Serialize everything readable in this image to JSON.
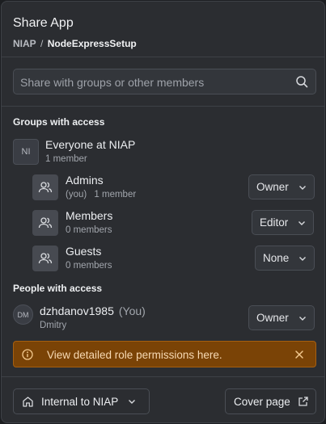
{
  "dialog": {
    "title": "Share App",
    "breadcrumb": {
      "org": "NIAP",
      "separator": "/",
      "app": "NodeExpressSetup"
    }
  },
  "search": {
    "placeholder": "Share with groups or other members",
    "icon": "search-icon"
  },
  "groups_section": {
    "label": "Groups with access",
    "org_group": {
      "initials": "NI",
      "name": "Everyone at NIAP",
      "members": "1 member"
    },
    "subgroups": [
      {
        "name": "Admins",
        "you": "(you)",
        "members": "1 member",
        "role": "Owner",
        "icon": "users-icon"
      },
      {
        "name": "Members",
        "members": "0 members",
        "role": "Editor",
        "icon": "users-icon"
      },
      {
        "name": "Guests",
        "members": "0 members",
        "role": "None",
        "icon": "users-icon"
      }
    ]
  },
  "people_section": {
    "label": "People with access",
    "people": [
      {
        "initials": "DM",
        "username": "dzhdanov1985",
        "you": "(You)",
        "display_name": "Dmitry",
        "role": "Owner"
      }
    ]
  },
  "banner": {
    "text": "View detailed role permissions here.",
    "color": "#7a4306"
  },
  "footer": {
    "visibility": "Internal to NIAP",
    "cover_page": "Cover page"
  }
}
